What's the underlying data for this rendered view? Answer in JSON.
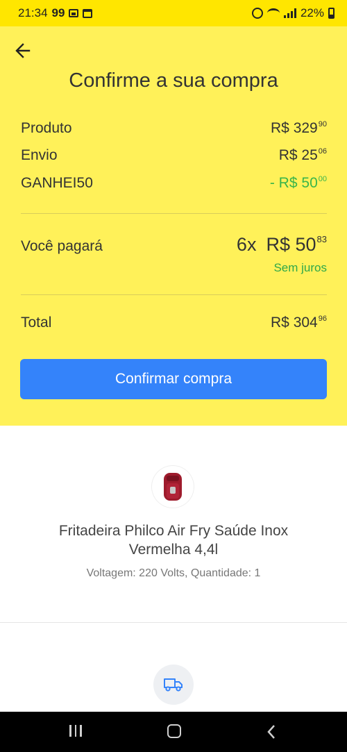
{
  "status_bar": {
    "time": "21:34",
    "notification_badge": "99",
    "battery_percent": "22%"
  },
  "header": {
    "title": "Confirme a sua compra"
  },
  "summary": [
    {
      "label": "Produto",
      "currency": "R$",
      "amount_main": "329",
      "amount_cents": "90"
    },
    {
      "label": "Envio",
      "currency": "R$",
      "amount_main": "25",
      "amount_cents": "06"
    },
    {
      "label": "GANHEI50",
      "currency": "- R$",
      "amount_main": "50",
      "amount_cents": "00",
      "color": "#39b54a"
    }
  ],
  "payment": {
    "label": "Você pagará",
    "installments": "6x",
    "currency": "R$",
    "amount_main": "50",
    "amount_cents": "83",
    "note": "Sem juros"
  },
  "total": {
    "label": "Total",
    "currency": "R$",
    "amount_main": "304",
    "amount_cents": "96"
  },
  "confirm_button": {
    "label": "Confirmar compra"
  },
  "product": {
    "title": "Fritadeira Philco Air Fry Saúde Inox Vermelha 4,4l",
    "details": "Voltagem: 220 Volts, Quantidade: 1"
  },
  "icons": {
    "back": "arrow-left-icon",
    "product": "air-fryer-image",
    "shipping": "truck-icon"
  },
  "colors": {
    "header_bg": "#fff159",
    "status_bar_bg": "#ffe600",
    "button_bg": "#3483fa",
    "discount": "#39b54a"
  }
}
